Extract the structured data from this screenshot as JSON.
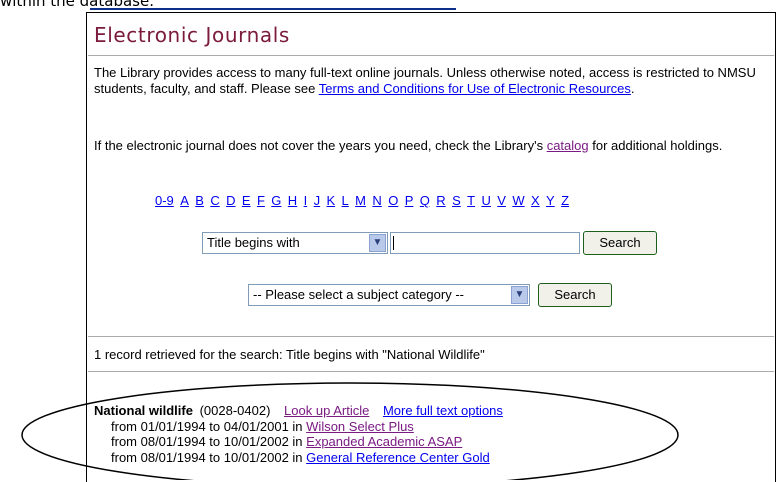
{
  "top_caption": "within the database.",
  "header": {
    "title": "Electronic Journals"
  },
  "intro": {
    "line_1_start": "The Library provides access to many full-text online journals. Unless otherwise noted, access is restricted to NMSU students, faculty, and staff. Please see ",
    "terms_link": "Terms and Conditions for Use of Electronic Resources",
    "line_1_end": "."
  },
  "coverage": {
    "text_start": "If the electronic journal does not cover the years you need, check the Library's ",
    "catalog_link": "catalog",
    "text_end": " for additional holdings."
  },
  "alphabet": [
    "0-9",
    "A",
    "B",
    "C",
    "D",
    "E",
    "F",
    "G",
    "H",
    "I",
    "J",
    "K",
    "L",
    "M",
    "N",
    "O",
    "P",
    "Q",
    "R",
    "S",
    "T",
    "U",
    "V",
    "W",
    "X",
    "Y",
    "Z"
  ],
  "title_search": {
    "mode_selected": "Title begins with",
    "query_value": "",
    "button_label": "Search"
  },
  "subject_search": {
    "selected": "-- Please select a subject category --",
    "button_label": "Search"
  },
  "results": {
    "status": "1 record retrieved for the search: Title begins with \"National Wildlife\"",
    "record": {
      "title": "National wildlife",
      "issn": "(0028-0402)",
      "lookup_link": "Look up Article",
      "more_link": "More full text options",
      "holdings": [
        {
          "range": "from 01/01/1994 to 04/01/2001 in ",
          "provider": "Wilson Select Plus"
        },
        {
          "range": "from 08/01/1994 to 10/01/2002 in ",
          "provider": "Expanded Academic ASAP"
        },
        {
          "range": "from 08/01/1994 to 10/01/2002 in ",
          "provider": "General Reference Center Gold"
        }
      ]
    }
  },
  "colors": {
    "title": "#7b1a3c",
    "link": "#0000ee",
    "visited": "#7a1a83",
    "button_border": "#1c5f1c"
  }
}
